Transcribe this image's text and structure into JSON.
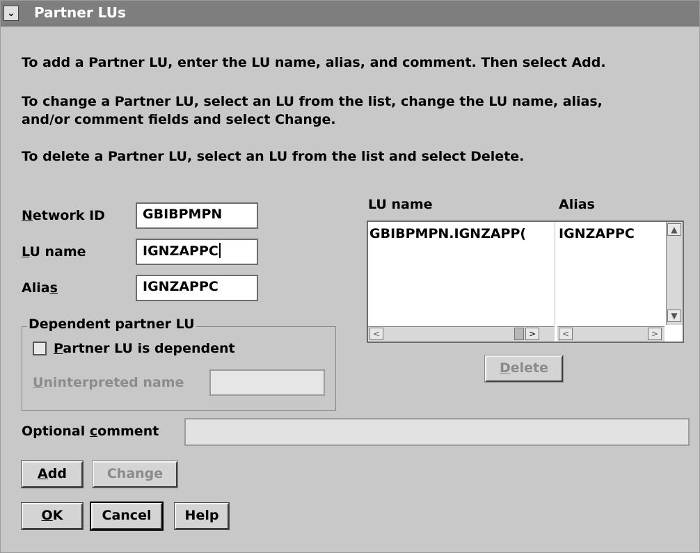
{
  "window": {
    "title": "Partner LUs",
    "sysmenu_glyph": "⌄"
  },
  "instructions": [
    "To add a Partner LU, enter the LU name, alias, and comment.  Then select Add.",
    "To change a Partner LU, select an LU from the list, change the LU name, alias,",
    "and/or comment fields and select Change.",
    "To delete a Partner LU, select an LU from the list and select Delete."
  ],
  "form": {
    "network_id": {
      "label_pre": "",
      "label_ul": "N",
      "label_post": "etwork ID",
      "value": "GBIBPMPN"
    },
    "lu_name": {
      "label_pre": "",
      "label_ul": "L",
      "label_post": "U name",
      "value": "IGNZAPPC"
    },
    "alias": {
      "label_pre": "Alia",
      "label_ul": "s",
      "label_post": "",
      "value": "IGNZAPPC"
    },
    "dependent_group": {
      "legend": "Dependent partner LU",
      "checkbox_pre": "",
      "checkbox_ul": "P",
      "checkbox_post": "artner LU is dependent",
      "checked": false,
      "uninterpreted_pre": "",
      "uninterpreted_ul": "U",
      "uninterpreted_post": "ninterpreted name",
      "uninterpreted_value": ""
    },
    "comment": {
      "label_pre": "Optional ",
      "label_ul": "c",
      "label_post": "omment",
      "value": ""
    }
  },
  "list": {
    "headers": {
      "lu_name": "LU name",
      "alias": "Alias"
    },
    "rows": [
      {
        "lu_name": "GBIBPMPN.IGNZAPP(",
        "alias": "IGNZAPPC"
      }
    ]
  },
  "buttons": {
    "delete": {
      "label_pre": "",
      "label_ul": "D",
      "label_post": "elete",
      "enabled": false
    },
    "add": {
      "label_pre": "",
      "label_ul": "A",
      "label_post": "dd",
      "enabled": true
    },
    "change": {
      "label_pre": "",
      "label_ul": "",
      "label_post": "Change",
      "enabled": false
    },
    "ok": {
      "label_pre": "",
      "label_ul": "O",
      "label_post": "K",
      "enabled": true
    },
    "cancel": {
      "label": "Cancel",
      "enabled": true
    },
    "help": {
      "label": "Help",
      "enabled": true
    }
  },
  "icons": {
    "scroll_up": "▲",
    "scroll_down": "▼",
    "scroll_left": "<",
    "scroll_right": ">"
  }
}
